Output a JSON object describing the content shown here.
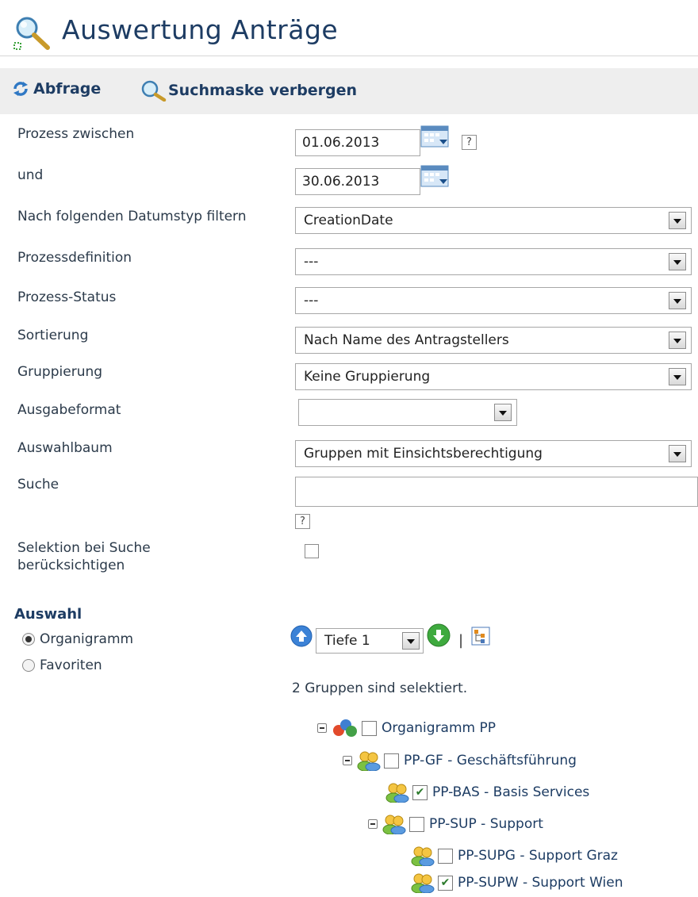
{
  "header": {
    "title": "Auswertung Anträge"
  },
  "toolbar": {
    "query_label": "Abfrage",
    "hide_search_label": "Suchmaske verbergen"
  },
  "form": {
    "process_between_label": "Prozess zwischen",
    "date_from": "01.06.2013",
    "and_label": "und",
    "date_to": "30.06.2013",
    "date_type_label": "Nach folgenden Datumstyp filtern",
    "date_type_value": "CreationDate",
    "process_definition_label": "Prozessdefinition",
    "process_definition_value": "---",
    "process_status_label": "Prozess-Status",
    "process_status_value": "---",
    "sort_label": "Sortierung",
    "sort_value": "Nach Name des Antragstellers",
    "grouping_label": "Gruppierung",
    "grouping_value": "Keine Gruppierung",
    "output_label": "Ausgabeformat",
    "output_value": "",
    "tree_label": "Auswahlbaum",
    "tree_value": "Gruppen mit Einsichtsberechtigung",
    "search_label": "Suche",
    "search_value": "",
    "consider_selection_label": "Selektion bei Suche berücksichtigen",
    "help_glyph": "?"
  },
  "selection": {
    "heading": "Auswahl",
    "options": [
      {
        "label": "Organigramm",
        "selected": true
      },
      {
        "label": "Favoriten",
        "selected": false
      }
    ],
    "depth_value": "Tiefe 1",
    "separator": "|",
    "selected_info": "2 Gruppen sind selektiert."
  },
  "tree": {
    "nodes": [
      {
        "label": "Organigramm PP",
        "checked": false,
        "icon": "org-chart-icon",
        "expanded": true
      },
      {
        "label": "PP-GF - Geschäftsführung",
        "checked": false,
        "icon": "group-icon",
        "expanded": true
      },
      {
        "label": "PP-BAS - Basis Services",
        "checked": true,
        "icon": "group-icon",
        "expanded": false
      },
      {
        "label": "PP-SUP - Support",
        "checked": false,
        "icon": "group-icon",
        "expanded": true
      },
      {
        "label": "PP-SUPG - Support Graz",
        "checked": false,
        "icon": "group-icon",
        "expanded": false
      },
      {
        "label": "PP-SUPW - Support Wien",
        "checked": true,
        "icon": "group-icon",
        "expanded": false
      }
    ]
  },
  "colors": {
    "title": "#1d3c63",
    "toolbar_bg": "#eeeeee",
    "check": "#2b7a2b"
  }
}
